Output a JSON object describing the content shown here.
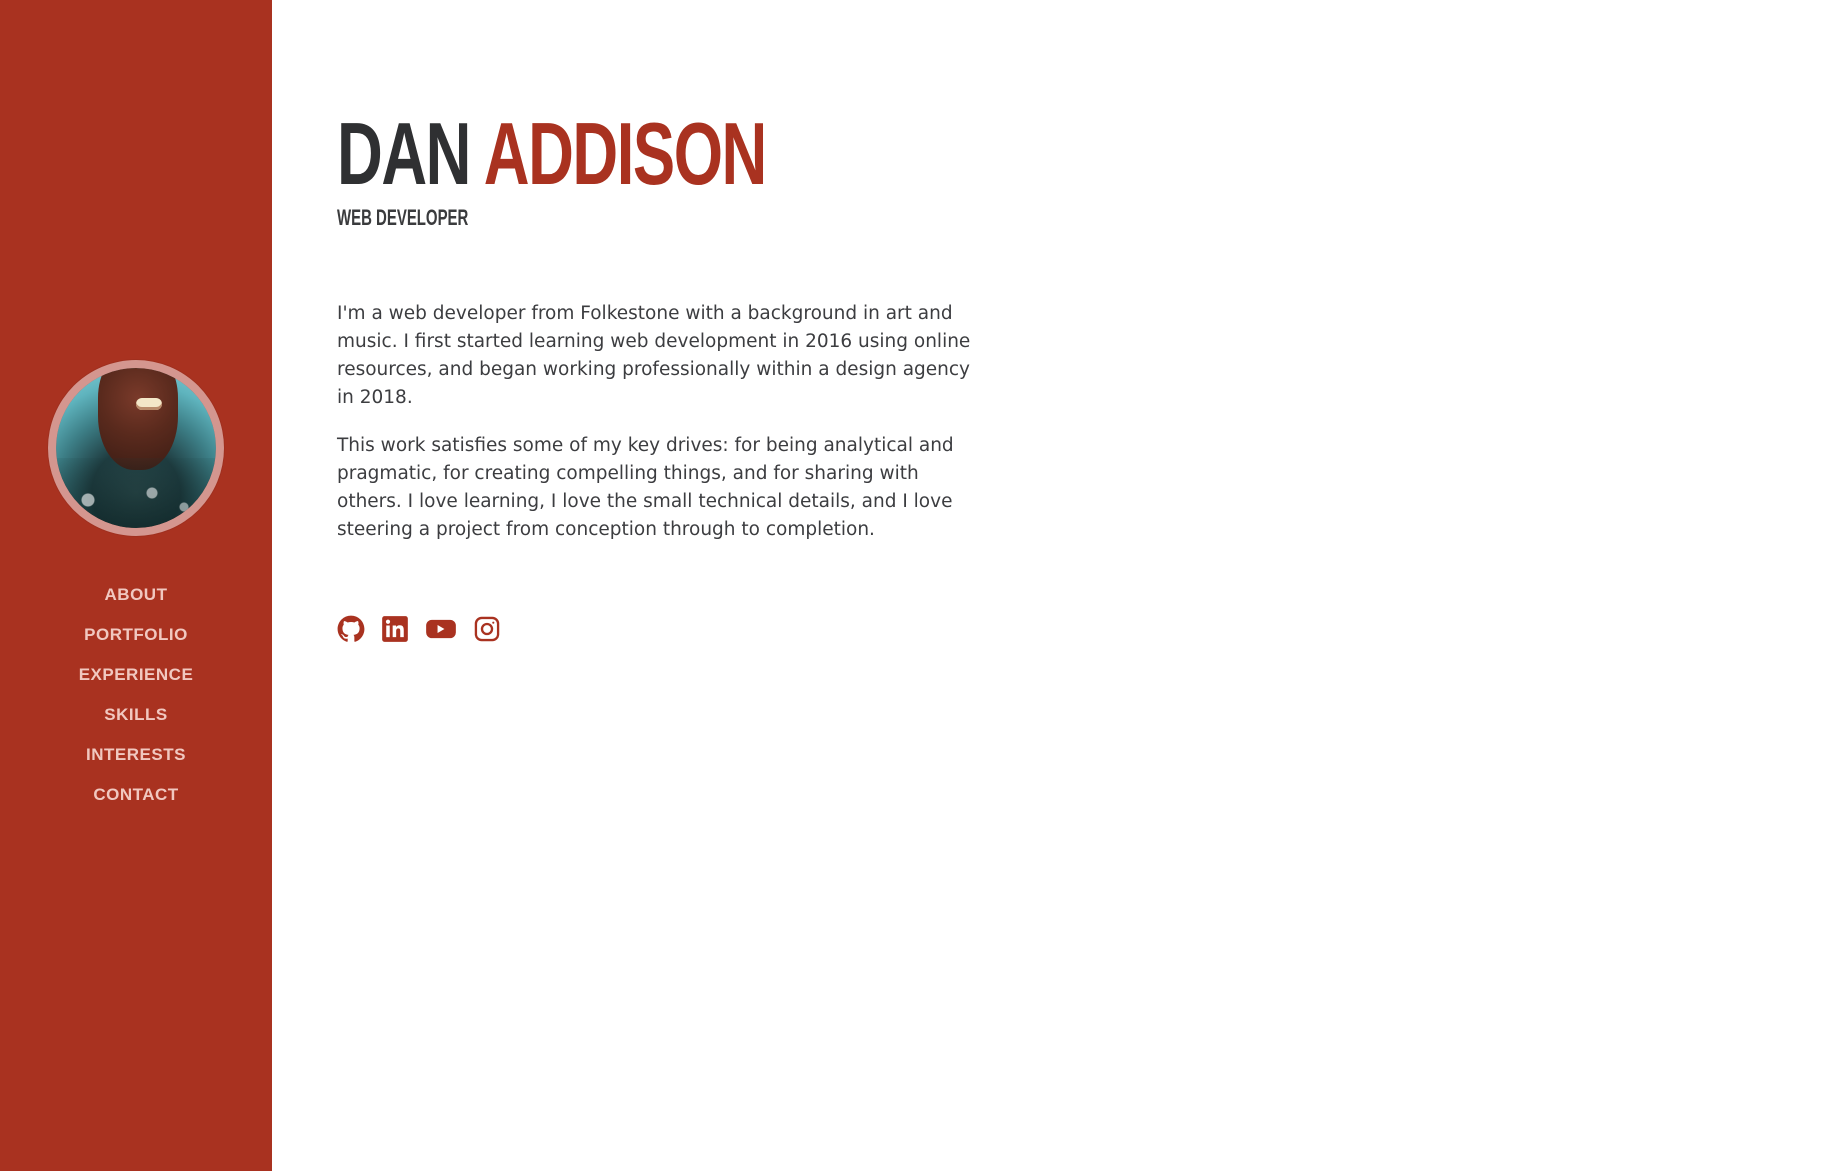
{
  "sidebar": {
    "bg_color": "#a93220",
    "avatar": {
      "alt": "profile photo"
    },
    "nav": [
      {
        "label": "ABOUT"
      },
      {
        "label": "PORTFOLIO"
      },
      {
        "label": "EXPERIENCE"
      },
      {
        "label": "SKILLS"
      },
      {
        "label": "INTERESTS"
      },
      {
        "label": "CONTACT"
      }
    ]
  },
  "main": {
    "first_name": "DAN",
    "last_name": "ADDISON",
    "subtitle": "WEB DEVELOPER",
    "bio": [
      "I'm a web developer from Folkestone with a background in art and music. I first started learning web development in 2016 using online resources, and began working professionally within a design agency in 2018.",
      "This work satisfies some of my key drives: for being analytical and pragmatic, for creating compelling things, and for sharing with others. I love learning, I love the small technical details, and I love steering a project from conception through to completion."
    ],
    "social": [
      {
        "icon": "github-icon"
      },
      {
        "icon": "linkedin-icon"
      },
      {
        "icon": "youtube-icon"
      },
      {
        "icon": "instagram-icon"
      }
    ]
  },
  "colors": {
    "accent": "#a93220",
    "text_dark": "#2f3032",
    "nav_text": "#f1c8c0"
  }
}
